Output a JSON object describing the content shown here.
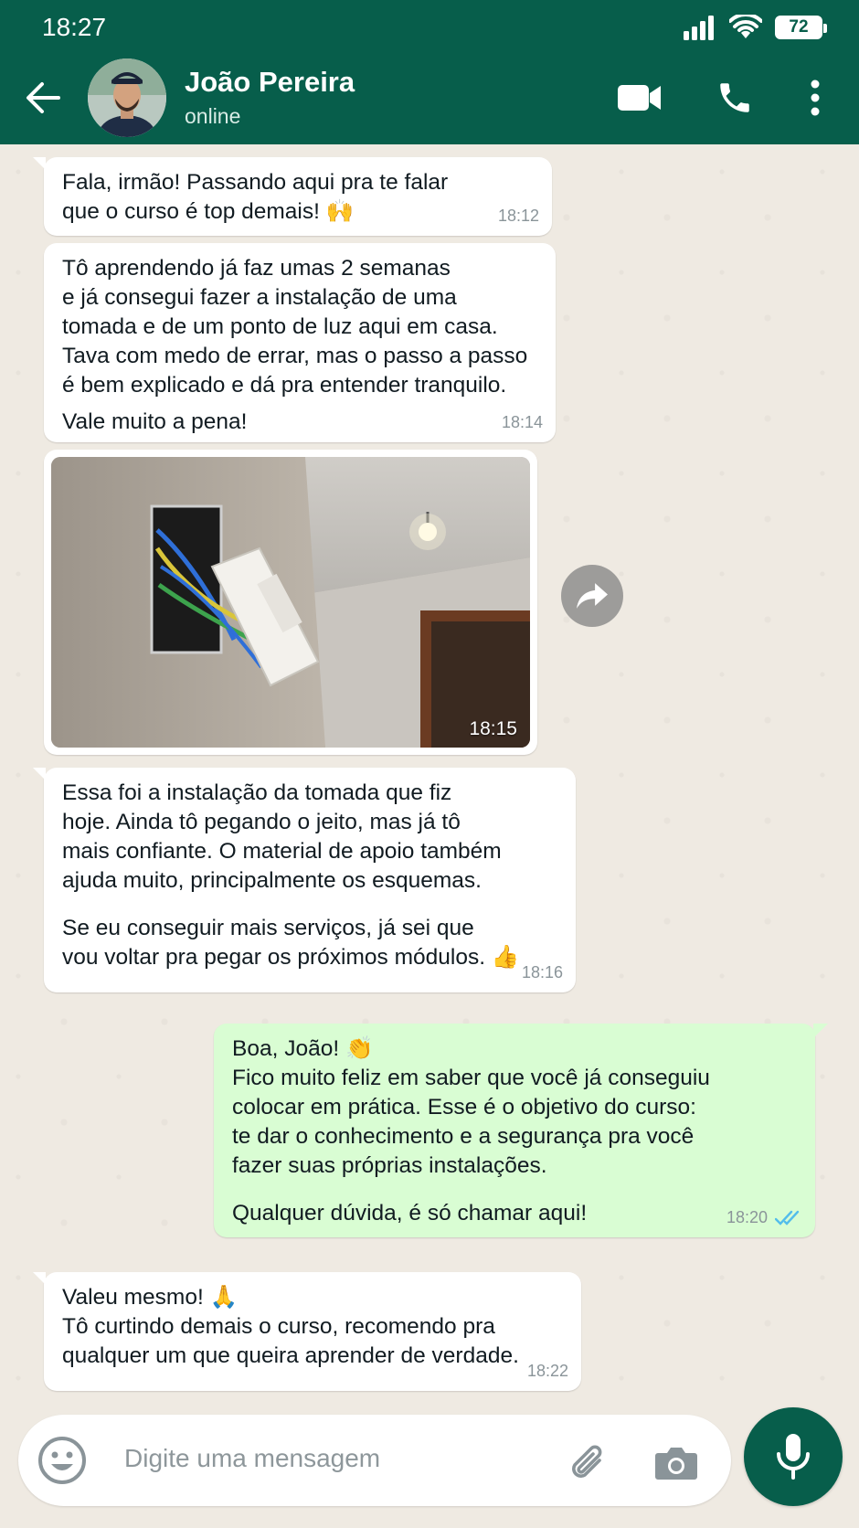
{
  "status_bar": {
    "time": "18:27",
    "battery": "72"
  },
  "header": {
    "contact_name": "João Pereira",
    "contact_status": "online"
  },
  "messages": [
    {
      "lines": [
        "Fala, irmão! Passando aqui pra te falar",
        "que o curso é top demais! 🙌"
      ],
      "time": "18:12"
    },
    {
      "lines": [
        "Tô aprendendo já faz umas 2 semanas",
        "e já consegui fazer a instalação de uma",
        "tomada e de um ponto de luz aqui em casa.",
        "Tava com medo de errar, mas o passo a passo",
        "é bem explicado e dá pra entender tranquilo."
      ],
      "lines2": [
        "Vale muito a pena!"
      ],
      "time": "18:14"
    },
    {
      "image_time": "18:15"
    },
    {
      "lines": [
        "Essa foi a instalação da tomada que fiz",
        "hoje. Ainda tô pegando o jeito, mas já tô",
        "mais confiante. O material de apoio também",
        "ajuda muito, principalmente os esquemas."
      ],
      "lines2": [
        "Se eu conseguir mais serviços, já sei que",
        "vou voltar pra pegar os próximos módulos. 👍"
      ],
      "time": "18:16"
    },
    {
      "lines": [
        "Boa, João! 👏",
        "Fico muito feliz em saber que você já conseguiu",
        "colocar em prática. Esse é o objetivo do curso:",
        "te dar o conhecimento e a segurança pra você",
        "fazer suas próprias instalações."
      ],
      "lines2": [
        "Qualquer dúvida, é só chamar aqui!"
      ],
      "time": "18:20"
    },
    {
      "lines": [
        "Valeu mesmo! 🙏",
        "Tô curtindo demais o curso, recomendo pra",
        "qualquer um que queira aprender de verdade."
      ],
      "time": "18:22"
    }
  ],
  "input": {
    "placeholder": "Digite uma mensagem"
  },
  "colors": {
    "header": "#075e4b",
    "outgoing_bubble": "#d9fdd3",
    "incoming_bubble": "#ffffff",
    "read_ticks": "#53bdeb",
    "chat_bg": "#efeae2"
  },
  "icons": [
    "back-arrow-icon",
    "video-call-icon",
    "phone-icon",
    "more-options-icon",
    "forward-icon",
    "emoji-icon",
    "attach-icon",
    "camera-icon",
    "mic-icon",
    "signal-icon",
    "wifi-icon",
    "double-check-icon"
  ]
}
